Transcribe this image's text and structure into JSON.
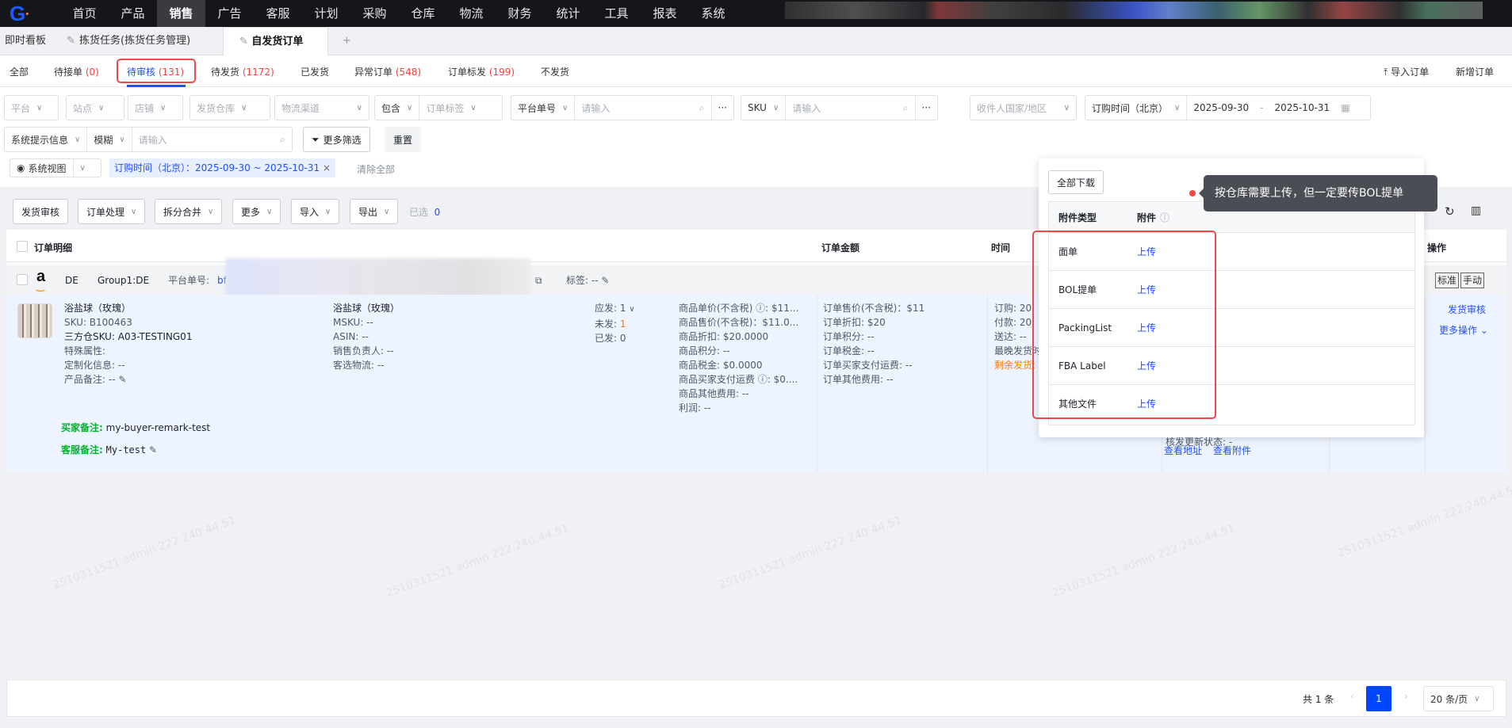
{
  "topnav": {
    "logo": "G",
    "items": [
      "首页",
      "产品",
      "销售",
      "广告",
      "客服",
      "计划",
      "采购",
      "仓库",
      "物流",
      "财务",
      "统计",
      "工具",
      "报表",
      "系统"
    ],
    "active": "销售"
  },
  "page_tabs": {
    "items": [
      "即时看板",
      "拣货任务(拣货任务管理)",
      "自发货订单"
    ],
    "add": "+"
  },
  "status_tabs": [
    {
      "label": "全部",
      "count": ""
    },
    {
      "label": "待接单",
      "count": "(0)"
    },
    {
      "label": "待审核",
      "count": "(131)"
    },
    {
      "label": "待发货",
      "count": "(1172)"
    },
    {
      "label": "已发货",
      "count": ""
    },
    {
      "label": "异常订单",
      "count": "(548)"
    },
    {
      "label": "订单标发",
      "count": "(199)"
    },
    {
      "label": "不发货",
      "count": ""
    }
  ],
  "header_actions": {
    "import": "导入订单",
    "new": "新增订单"
  },
  "filters": {
    "platform": "平台",
    "site": "站点",
    "shop": "店铺",
    "warehouse": "发货仓库",
    "channel": "物流渠道",
    "contains": "包含",
    "order_tag": "订单标签",
    "platform_no": "平台单号",
    "placeholder": "请输入",
    "sku": "SKU",
    "country": "收件人国家/地区",
    "time_type": "订购时间（北京）",
    "date_from": "2025-09-30",
    "date_sep": "-",
    "date_to": "2025-10-31",
    "sys_info": "系统提示信息",
    "fuzzy": "模糊",
    "more_filter": "更多筛选",
    "reset": "重置",
    "view": "系统视图",
    "active_tag": "订购时间（北京）：2025-09-30 ~ 2025-10-31",
    "clear_all": "清除全部"
  },
  "actions": {
    "audit": "发货审核",
    "process": "订单处理",
    "split": "拆分合并",
    "more": "更多",
    "import": "导入",
    "export": "导出",
    "selected_label": "已选",
    "selected_count": "0"
  },
  "table": {
    "headers": {
      "detail": "订单明细",
      "amount": "订单金额",
      "time": "时间",
      "ops": "操作"
    },
    "group": {
      "site": "DE",
      "group": "Group1:DE",
      "platform_no_label": "平台单号:",
      "platform_no": "bf",
      "tag": "标签: --",
      "badge1": "标准",
      "badge2": "手动"
    },
    "row": {
      "name": "浴盐球（玫瑰）",
      "sku": "SKU:  B100463",
      "tp_sku": "三方仓SKU:  A03-TESTING01",
      "special": "特殊属性:",
      "custom": "定制化信息:  --",
      "remark": "产品备注:  --",
      "name2": "浴盐球（玫瑰）",
      "msku": "MSKU:  --",
      "asin": "ASIN:  --",
      "sales": "销售负责人:  --",
      "logistics": "客选物流:  --",
      "qty_should": "应发:  1",
      "qty_unsent_label": "未发: ",
      "qty_unsent": "1",
      "qty_sent": "已发:  0",
      "price": [
        "商品单价(不含税) ⓘ: $11...",
        "商品售价(不含税)：$11.0...",
        "商品折扣:  $20.0000",
        "商品积分:  --",
        "商品税金:  $0.0000",
        "商品买家支付运费 ⓘ: $0....",
        "商品其他费用:  --",
        "利润:  --"
      ],
      "order": [
        "订单售价(不含税)：$11",
        "订单折扣:  $20",
        "订单积分:  --",
        "订单税金:  --",
        "订单买家支付运费:  --",
        "订单其他费用:  --"
      ],
      "time": [
        "订购:  20",
        "付款:  20",
        "送达:  --",
        "最晚发货时",
        "剩余发货:"
      ],
      "buyer_label": "买家备注:",
      "buyer_value": "my-buyer-remark-test",
      "cs_label": "客服备注:",
      "cs_value": "My-test",
      "status_partial": "核发更新状态:  -",
      "view_address": "查看地址",
      "view_attach": "查看附件",
      "op_audit": "发货审核",
      "op_more": "更多操作 ⌄"
    }
  },
  "popover": {
    "download_all": "全部下载",
    "col_type": "附件类型",
    "col_file": "附件",
    "rows": [
      {
        "type": "面单",
        "action": "上传"
      },
      {
        "type": "BOL提单",
        "action": "上传"
      },
      {
        "type": "PackingList",
        "action": "上传"
      },
      {
        "type": "FBA Label",
        "action": "上传"
      },
      {
        "type": "其他文件",
        "action": "上传"
      }
    ]
  },
  "tooltip": "按仓库需要上传，但一定要传BOL提单",
  "pagination": {
    "total": "共 1 条",
    "page": "1",
    "page_size": "20 条/页"
  },
  "watermark": "2510311521 admin 222.240.44.51"
}
